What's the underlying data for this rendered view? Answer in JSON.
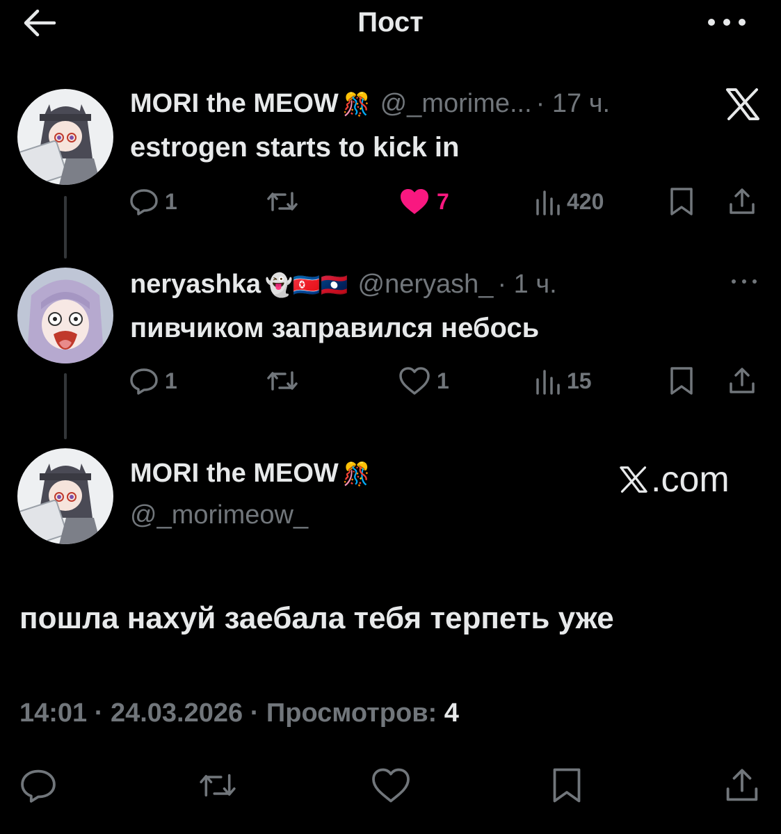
{
  "header": {
    "title": "Пост",
    "back_icon": "arrow-left-icon",
    "more_icon": "more-horizontal-icon"
  },
  "thread": [
    {
      "display_name": "MORI the MEOW",
      "name_emoji": "🎊",
      "handle": "@_morime...",
      "time": "· 17 ч.",
      "text": "estrogen starts to kick in",
      "replies": "1",
      "likes": "7",
      "liked": true,
      "views": "420",
      "badge_icon": "x-logo-icon"
    },
    {
      "display_name": "neryashka",
      "name_emoji": "👻🇰🇵🇱🇦",
      "handle": "@neryash_",
      "time": "· 1 ч.",
      "text": "пивчиком заправился небось",
      "replies": "1",
      "likes": "1",
      "liked": false,
      "views": "15"
    }
  ],
  "main_post": {
    "display_name": "MORI the MEOW",
    "name_emoji": "🎊",
    "handle": "@_morimeow_",
    "watermark": ".com",
    "text": "пошла нахуй заебала тебя терпеть уже",
    "timestamp": "14:01 · 24.03.2026 · Просмотров: ",
    "views": "4"
  },
  "colors": {
    "background": "#000000",
    "text": "#e7e9ea",
    "muted": "#71767b",
    "like": "#f91880",
    "line": "#333639"
  }
}
